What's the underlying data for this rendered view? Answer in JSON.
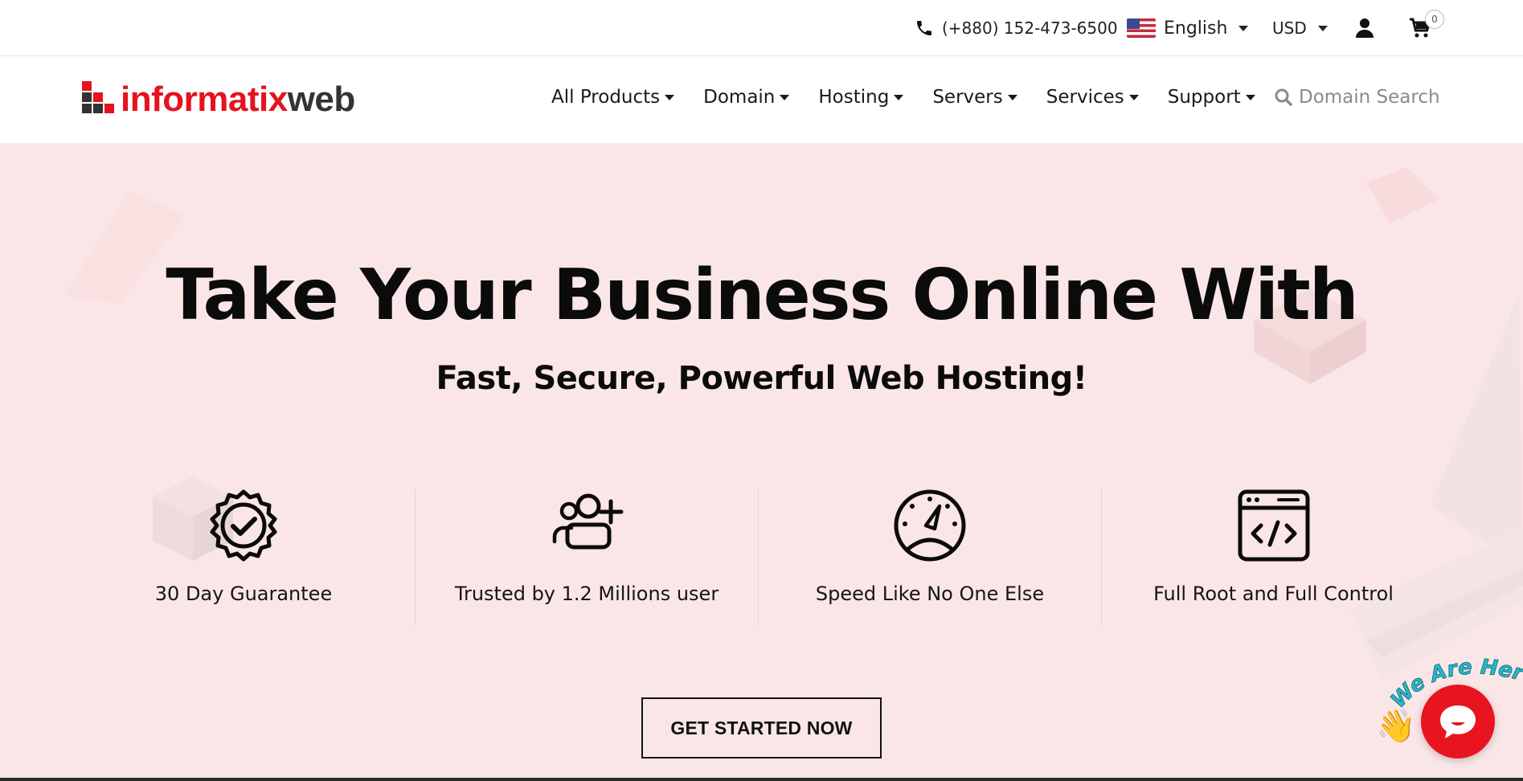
{
  "topbar": {
    "phone": "(+880) 152-473-6500",
    "language": "English",
    "currency": "USD",
    "cart_count": "0"
  },
  "brand": {
    "logo_red": "informatix",
    "logo_dark": "web",
    "accent": "#e4141e"
  },
  "nav": {
    "items": [
      {
        "label": "All Products"
      },
      {
        "label": "Domain"
      },
      {
        "label": "Hosting"
      },
      {
        "label": "Servers"
      },
      {
        "label": "Services"
      },
      {
        "label": "Support"
      }
    ],
    "search_label": "Domain Search"
  },
  "hero": {
    "title": "Take Your Business Online With",
    "subtitle": "Fast, Secure, Powerful Web Hosting!",
    "features": [
      {
        "icon": "badge-check-icon",
        "label": "30 Day Guarantee"
      },
      {
        "icon": "user-plus-icon",
        "label": "Trusted by 1.2 Millions user"
      },
      {
        "icon": "speedometer-icon",
        "label": "Speed Like No One Else"
      },
      {
        "icon": "code-window-icon",
        "label": "Full Root and Full Control"
      }
    ],
    "cta": "GET STARTED NOW",
    "background": "#fbe6e7"
  },
  "chat": {
    "badge_text": "We Are Here!"
  }
}
